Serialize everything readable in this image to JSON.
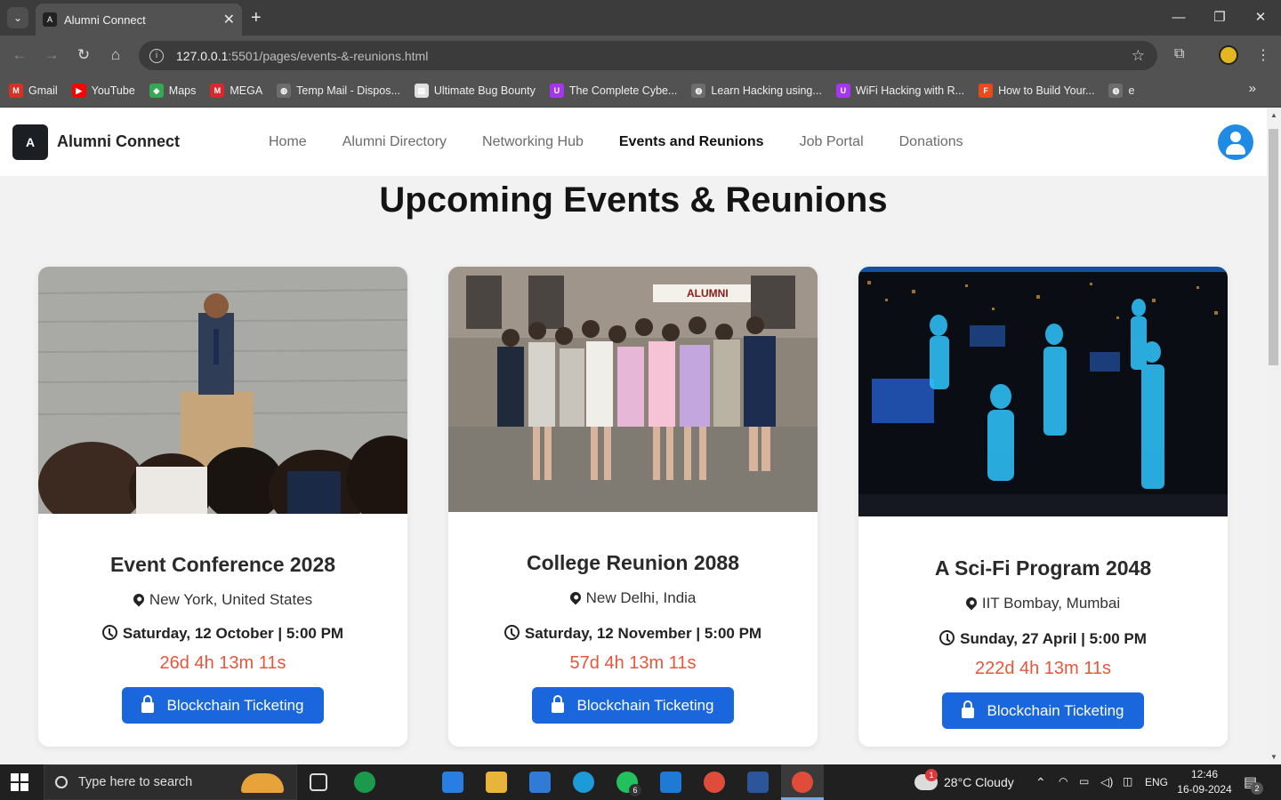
{
  "browser": {
    "tab_title": "Alumni Connect",
    "url_host": "127.0.0.1",
    "url_rest": ":5501/pages/events-&-reunions.html",
    "bookmarks": [
      {
        "label": "Gmail",
        "icon": "gmail-icon",
        "color": "#d93025",
        "glyph": "M"
      },
      {
        "label": "YouTube",
        "icon": "youtube-icon",
        "color": "#ff0000",
        "glyph": "▶"
      },
      {
        "label": "Maps",
        "icon": "maps-icon",
        "color": "#34a853",
        "glyph": "◆"
      },
      {
        "label": "MEGA",
        "icon": "mega-icon",
        "color": "#d9272e",
        "glyph": "M"
      },
      {
        "label": "Temp Mail - Dispos...",
        "icon": "globe-icon",
        "color": "#6d6d6d",
        "glyph": "◍"
      },
      {
        "label": "Ultimate Bug Bounty",
        "icon": "bug-bounty-icon",
        "color": "#e0e0e0",
        "glyph": "▤"
      },
      {
        "label": "The Complete Cybe...",
        "icon": "udemy-icon",
        "color": "#a435f0",
        "glyph": "U"
      },
      {
        "label": "Learn Hacking using...",
        "icon": "globe-icon",
        "color": "#6d6d6d",
        "glyph": "◍"
      },
      {
        "label": "WiFi Hacking with R...",
        "icon": "udemy-icon",
        "color": "#a435f0",
        "glyph": "U"
      },
      {
        "label": "How to Build Your...",
        "icon": "hackernoon-icon",
        "color": "#e8491d",
        "glyph": "F"
      },
      {
        "label": "e",
        "icon": "globe-icon",
        "color": "#6d6d6d",
        "glyph": "◍"
      }
    ]
  },
  "site": {
    "brand": "Alumni Connect",
    "logo_glyph": "A",
    "nav": [
      {
        "label": "Home",
        "active": false
      },
      {
        "label": "Alumni Directory",
        "active": false
      },
      {
        "label": "Networking Hub",
        "active": false
      },
      {
        "label": "Events and Reunions",
        "active": true
      },
      {
        "label": "Job Portal",
        "active": false
      },
      {
        "label": "Donations",
        "active": false
      }
    ],
    "page_title": "Upcoming Events & Reunions",
    "accent_color": "#1a66dd",
    "countdown_color": "#e8553a"
  },
  "events": [
    {
      "title": "Event Conference 2028",
      "location": "New York, United States",
      "datetime": "Saturday, 12 October | 5:00 PM",
      "countdown": "26d 4h 13m 11s",
      "button": "Blockchain Ticketing",
      "image": "conference-speaker-photo"
    },
    {
      "title": "College Reunion 2088",
      "location": "New Delhi, India",
      "datetime": "Saturday, 12 November | 5:00 PM",
      "countdown": "57d 4h 13m 11s",
      "button": "Blockchain Ticketing",
      "image": "alumni-group-photo"
    },
    {
      "title": "A Sci-Fi Program 2048",
      "location": "IIT Bombay, Mumbai",
      "datetime": "Sunday, 27 April | 5:00 PM",
      "countdown": "222d 4h 13m 11s",
      "button": "Blockchain Ticketing",
      "image": "hologram-people-photo"
    }
  ],
  "taskbar": {
    "search_placeholder": "Type here to search",
    "weather": "28°C  Cloudy",
    "language": "ENG",
    "time": "12:46",
    "date": "16-09-2024",
    "whatsapp_badge": "6",
    "notif_badge": "2",
    "weather_badge": "1"
  }
}
